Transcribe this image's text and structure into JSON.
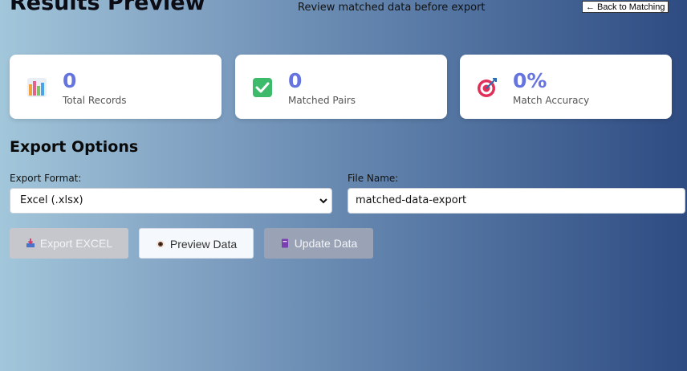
{
  "header": {
    "title": "Results Preview",
    "subtitle": "Review matched data before export",
    "back_button": "← Back to Matching"
  },
  "stats": [
    {
      "icon": "bar-chart-icon",
      "value": "0",
      "label": "Total Records"
    },
    {
      "icon": "check-mark-icon",
      "value": "0",
      "label": "Matched Pairs"
    },
    {
      "icon": "target-icon",
      "value": "0%",
      "label": "Match Accuracy"
    }
  ],
  "export": {
    "section_title": "Export Options",
    "format_label": "Export Format:",
    "format_value": "Excel (.xlsx)",
    "filename_label": "File Name:",
    "filename_value": "matched-data-export"
  },
  "actions": {
    "export_label": "Export EXCEL",
    "preview_label": "Preview Data",
    "update_label": "Update Data"
  },
  "colors": {
    "accent": "#6674e0",
    "disabled_export": "#c6c7cc",
    "update_button": "#9aa3b5"
  }
}
